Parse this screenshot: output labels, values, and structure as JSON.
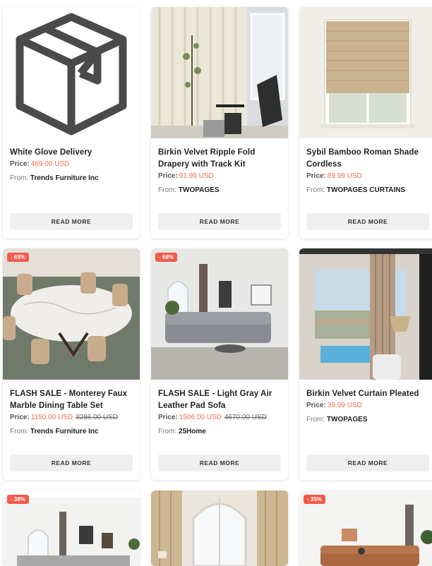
{
  "read_more_label": "READ MORE",
  "price_label": "Price:",
  "from_label": "From:",
  "colors": {
    "accent": "#f26b4a",
    "badge": "#f05a4a"
  },
  "products": [
    {
      "title": "White Glove Delivery",
      "price": "469.00 USD",
      "old_price": "",
      "vendor": "Trends Furniture Inc",
      "badge": "",
      "image": "box-icon"
    },
    {
      "title": "Birkin Velvet Ripple Fold Drapery with Track Kit",
      "price": "91.99 USD",
      "old_price": "",
      "vendor": "TWOPAGES",
      "badge": "",
      "image": "curtain-room-photo"
    },
    {
      "title": "Sybil Bamboo Roman Shade Cordless",
      "price": "89.99 USD",
      "old_price": "",
      "vendor": "TWOPAGES CURTAINS",
      "badge": "",
      "image": "roman-shade-photo"
    },
    {
      "title": "FLASH SALE - Monterey Faux Marble Dining Table Set",
      "price": "1150.00 USD",
      "old_price": "3286.00 USD",
      "vendor": "Trends Furniture Inc",
      "badge": "- 65%",
      "image": "dining-table-photo"
    },
    {
      "title": "FLASH SALE - Light Gray Air Leather Pad Sofa",
      "price": "1506.00 USD",
      "old_price": "4670.00 USD",
      "vendor": "25Home",
      "badge": "- 68%",
      "image": "gray-sofa-photo"
    },
    {
      "title": "Birkin Velvet Curtain Pleated",
      "price": "39.99 USD",
      "old_price": "",
      "vendor": "TWOPAGES",
      "badge": "",
      "image": "pleated-curtain-photo"
    },
    {
      "badge": "- 38%",
      "image": "living-room-photo"
    },
    {
      "badge": "",
      "image": "arched-window-photo"
    },
    {
      "badge": "- 35%",
      "image": "brown-sofa-photo"
    }
  ]
}
